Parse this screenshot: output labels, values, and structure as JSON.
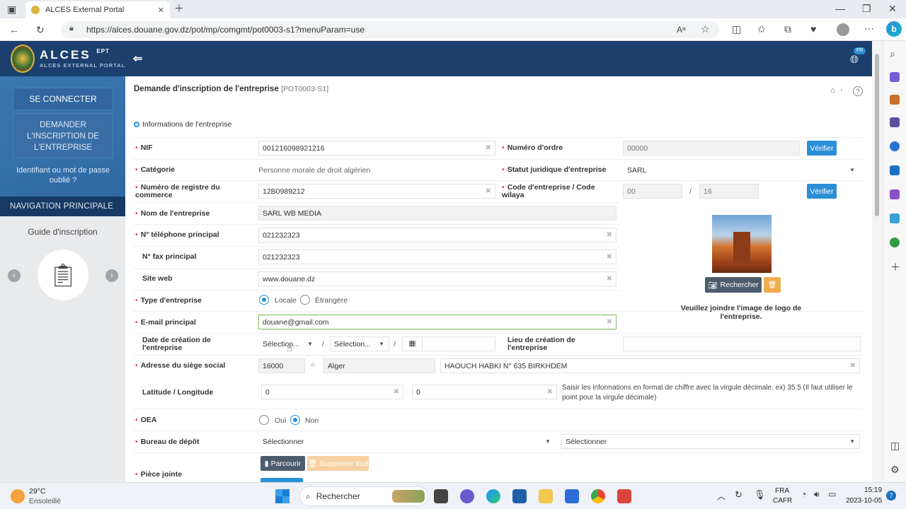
{
  "browser": {
    "tab_title": "ALCES External Portal",
    "url": "https://alces.douane.gov.dz/pot/mp/comgmt/pot0003-s1?menuParam=use"
  },
  "header": {
    "brand": "ALCES",
    "brand_sup": "EPT",
    "brand_sub": "ALCES EXTERNAL PORTAL",
    "lang": "FR"
  },
  "sidebar": {
    "login_label": "SE CONNECTER",
    "register_label": "DEMANDER L'INSCRIPTION DE L'ENTREPRISE",
    "forgot_label": "Identifiant ou mot de passe oublié ?",
    "nav_heading": "NAVIGATION PRINCIPALE",
    "guide_label": "Guide d'inscription"
  },
  "page": {
    "title": "Demande d'inscription de l'entreprise",
    "code": "[POT0003-S1]",
    "section_title": "Informations de l'entreprise"
  },
  "form": {
    "nif_label": "NIF",
    "nif_value": "001216098921216",
    "ordre_label": "Numéro d'ordre",
    "ordre_value": "00000",
    "verify_label": "Vérifier",
    "categorie_label": "Catégorie",
    "categorie_value": "Personne morale de droit algérien",
    "statut_label": "Statut juridique d'entreprise",
    "statut_value": "SARL",
    "registre_label": "Numéro de registre du commerce",
    "registre_value": "12B0989212",
    "code_ent_label": "Code d'entreprise / Code wilaya",
    "code_ent_value": "00",
    "code_wilaya_value": "16",
    "slash": "/",
    "nom_label": "Nom de l'entreprise",
    "nom_value": "SARL  WB MEDIA",
    "tel_label": "N° téléphone principal",
    "tel_value": "021232323",
    "fax_label": "N° fax principal",
    "fax_value": "021232323",
    "site_label": "Site web",
    "site_value": "www.douane.dz",
    "type_label": "Type d'entreprise",
    "type_locale": "Locale",
    "type_etrangere": "Étrangère",
    "email_label": "E-mail principal",
    "email_value": "douane@gmail.com",
    "date_label": "Date de création de l'entreprise",
    "date_select1": "Sélection...",
    "date_select2": "Sélection...",
    "lieu_label": "Lieu de création de l'entreprise",
    "adresse_label": "Adresse du siège social",
    "adresse_code": "16000",
    "adresse_ville": "Alger",
    "adresse_rue": "HAOUCH HABKI N° 635 BIRKHDEM",
    "latlng_label": "Latitude / Longitude",
    "lat_value": "0",
    "lng_value": "0",
    "latlng_hint": "Saisir les informations en format de chiffre avec la virgule décimale. ex) 35.5 (Il faut utiliser le point pour la virgule décimale)",
    "oea_label": "OEA",
    "oea_oui": "Oui",
    "oea_non": "Non",
    "bureau_label": "Bureau de dépôt",
    "bureau_select1": "Sélectionner",
    "bureau_select2": "Sélectionner",
    "piece_label": "Pièce jointe",
    "parcourir_label": "Parcourir",
    "supprimer_label": "Supprimer tout",
    "logo_search_label": "Rechercher",
    "logo_hint": "Veuillez joindre l'image de logo de l'entreprise."
  },
  "taskbar": {
    "weather_temp": "29°C",
    "weather_desc": "Ensoleillé",
    "search_label": "Rechercher",
    "lang_top": "FRA",
    "lang_bottom": "CAFR",
    "time": "15:19",
    "date": "2023-10-05",
    "notif_count": "7"
  }
}
